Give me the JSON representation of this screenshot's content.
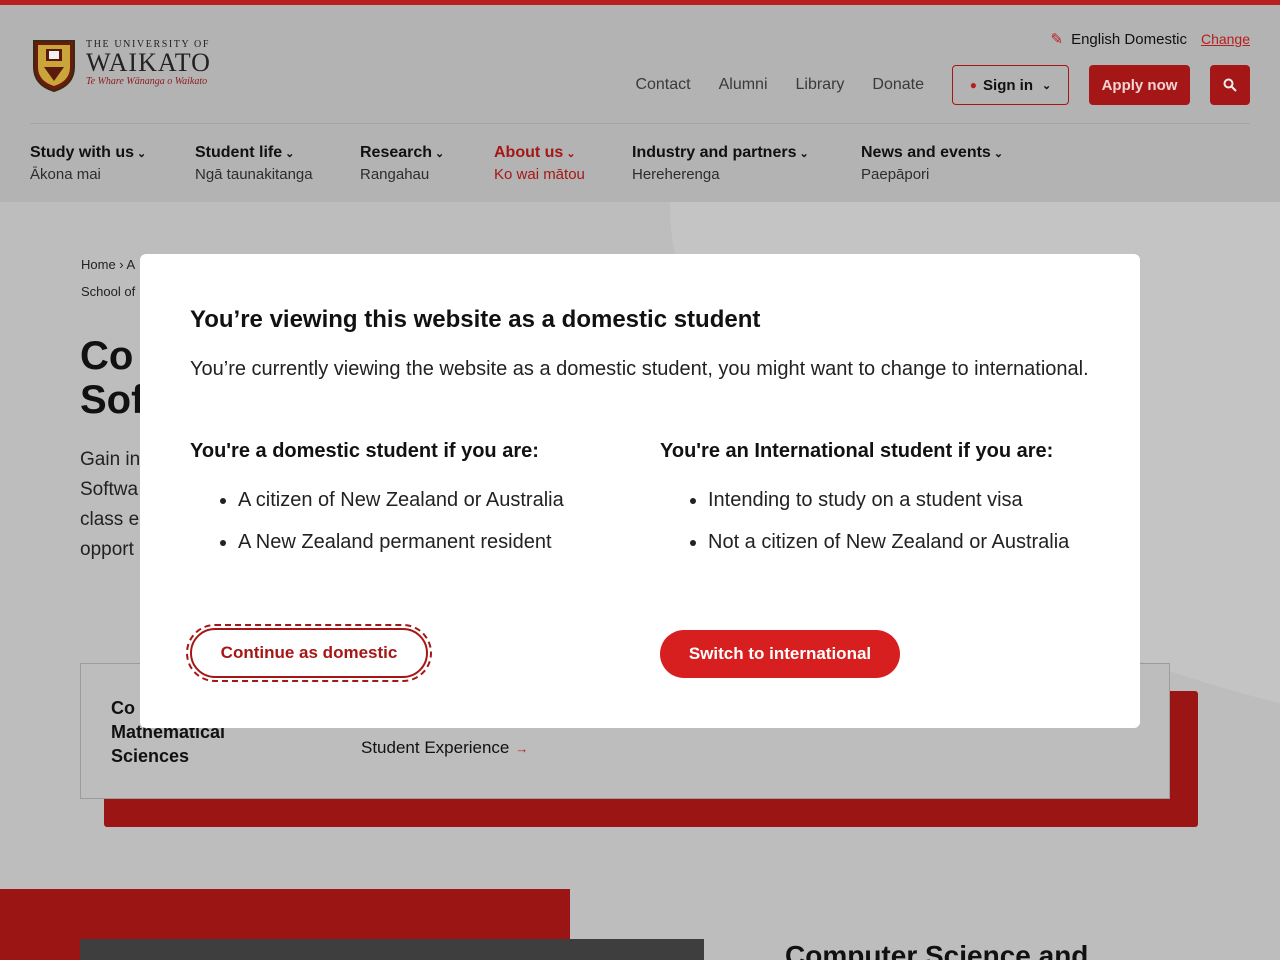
{
  "header": {
    "logo": {
      "line1": "THE UNIVERSITY OF",
      "line2": "WAIKATO",
      "line3": "Te Whare Wānanga o Waikato"
    },
    "locale": {
      "label": "English Domestic",
      "change": "Change"
    },
    "utility_links": [
      "Contact",
      "Alumni",
      "Library",
      "Donate"
    ],
    "sign_in": "Sign in",
    "apply": "Apply now",
    "nav": [
      {
        "en": "Study with us",
        "mi": "Ākona mai"
      },
      {
        "en": "Student life",
        "mi": "Ngā taunakitanga"
      },
      {
        "en": "Research",
        "mi": "Rangahau"
      },
      {
        "en": "About us",
        "mi": "Ko wai mātou"
      },
      {
        "en": "Industry and partners",
        "mi": "Hereherenga"
      },
      {
        "en": "News and events",
        "mi": "Paepāpori"
      }
    ],
    "active_nav": "About us"
  },
  "background": {
    "breadcrumb1": "Home  ›  A",
    "breadcrumb2": "School of",
    "title_line1": "Co",
    "title_line2": "Sof",
    "intro": [
      "Gain in",
      "Softwa",
      "class e",
      "opport"
    ],
    "card_left": [
      "Co",
      "Mathematical",
      "Sciences"
    ],
    "card_link": "Student Experience",
    "section_heading": "Computer Science and"
  },
  "modal": {
    "title": "You’re viewing this website as a domestic student",
    "body": "You’re currently viewing the website as a domestic student, you might want to change to international.",
    "domestic_heading": "You're a domestic student if you are:",
    "domestic_items": [
      "A citizen of New Zealand or Australia",
      "A New Zealand permanent resident"
    ],
    "international_heading": "You're an International student if you are:",
    "international_items": [
      "Intending to study on a student visa",
      "Not a citizen of New Zealand or Australia"
    ],
    "continue_button": "Continue as domestic",
    "switch_button": "Switch to international"
  },
  "colors": {
    "brand_red": "#d81f1f",
    "overlay": "#b3b3b3"
  }
}
